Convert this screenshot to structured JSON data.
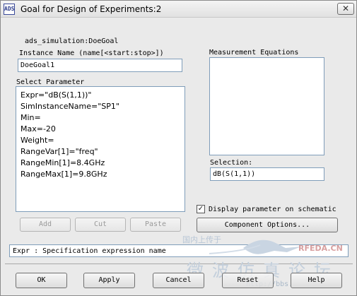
{
  "window": {
    "title": "Goal for Design of Experiments:2",
    "close_glyph": "✕",
    "app_icon_text": "ADS"
  },
  "component_name": "ads_simulation:DoeGoal",
  "instance": {
    "label": "Instance Name  (name[<start:stop>])",
    "value": "DoeGoal1"
  },
  "select_parameter": {
    "label": "Select Parameter",
    "items": [
      "Expr=\"dB(S(1,1))\"",
      "SimInstanceName=\"SP1\"",
      "Min=",
      "Max=-20",
      "Weight=",
      "RangeVar[1]=\"freq\"",
      "RangeMin[1]=8.4GHz",
      "RangeMax[1]=9.8GHz"
    ]
  },
  "list_buttons": {
    "add": "Add",
    "cut": "Cut",
    "paste": "Paste"
  },
  "measurement_equations": {
    "label": "Measurement Equations"
  },
  "selection": {
    "label": "Selection:",
    "value": "dB(S(1,1))"
  },
  "display_param": {
    "label": "Display parameter on schematic",
    "checked": true,
    "check_glyph": "✓"
  },
  "component_options_button": "Component Options...",
  "status_text": "Expr : Specification expression name",
  "footer_buttons": {
    "ok": "OK",
    "apply": "Apply",
    "cancel": "Cancel",
    "reset": "Reset",
    "help": "Help"
  },
  "watermark": {
    "brand": "RFEDA.CN",
    "line1": "微波仿真论坛",
    "line2": "http://bbs.rfeda.cn",
    "line3": "国内上传于"
  }
}
